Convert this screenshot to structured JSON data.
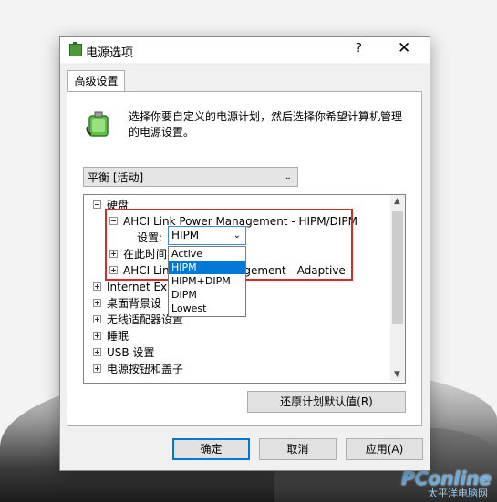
{
  "window": {
    "title": "电源选项",
    "help": "?",
    "close": "✕"
  },
  "tab": {
    "label": "高级设置"
  },
  "description": "选择你要自定义的电源计划，然后选择你希望计算机管理的电源设置。",
  "plan_select": {
    "value": "平衡 [活动]"
  },
  "tree": {
    "items": [
      {
        "label": "硬盘",
        "expander": "minus"
      },
      {
        "label": "AHCI Link Power Management - HIPM/DIPM",
        "expander": "minus"
      },
      {
        "label": "设置:"
      },
      {
        "label": "在此时间",
        "expander": "plus"
      },
      {
        "label": "AHCI Lin",
        "label_tail": "agement - Adaptive",
        "expander": "plus"
      },
      {
        "label": "Internet Expl",
        "expander": "plus"
      },
      {
        "label": "桌面背景设",
        "expander": "plus"
      },
      {
        "label": "无线适配器设置",
        "expander": "plus"
      },
      {
        "label": "睡眠",
        "expander": "plus"
      },
      {
        "label": "USB 设置",
        "expander": "plus"
      },
      {
        "label": "电源按钮和盖子",
        "expander": "plus"
      }
    ]
  },
  "setting_select": {
    "value": "HIPM",
    "options": [
      "Active",
      "HIPM",
      "HIPM+DIPM",
      "DIPM",
      "Lowest"
    ],
    "selected_index": 1
  },
  "buttons": {
    "restore": "还原计划默认值(R)",
    "ok": "确定",
    "cancel": "取消",
    "apply": "应用(A)"
  },
  "watermark": {
    "brand": "PConline",
    "sub": "太平洋电脑网"
  },
  "colors": {
    "highlight_border": "#d92a2a",
    "selection": "#0078d7"
  }
}
